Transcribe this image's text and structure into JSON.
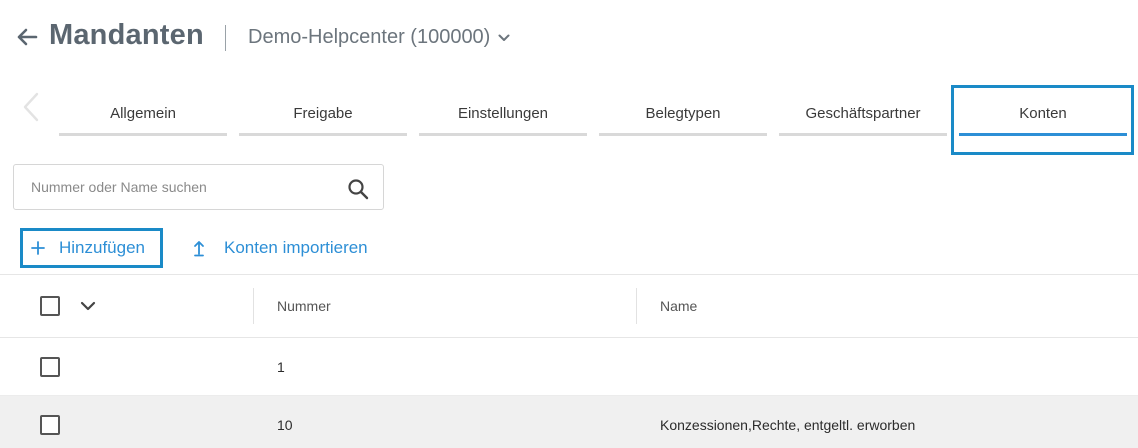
{
  "header": {
    "title": "Mandanten",
    "tenant": "Demo-Helpcenter (100000)"
  },
  "tabs": [
    {
      "label": "Allgemein",
      "active": false
    },
    {
      "label": "Freigabe",
      "active": false
    },
    {
      "label": "Einstellungen",
      "active": false
    },
    {
      "label": "Belegtypen",
      "active": false
    },
    {
      "label": "Geschäftspartner",
      "active": false
    },
    {
      "label": "Konten",
      "active": true
    }
  ],
  "search": {
    "placeholder": "Nummer oder Name suchen",
    "value": ""
  },
  "actions": {
    "add_label": "Hinzufügen",
    "import_label": "Konten importieren"
  },
  "table": {
    "columns": [
      "Nummer",
      "Name"
    ],
    "rows": [
      {
        "nummer": "1",
        "name": ""
      },
      {
        "nummer": "10",
        "name": "Konzessionen,Rechte, entgeltl. erworben"
      }
    ]
  },
  "colors": {
    "accent": "#2d8fd6",
    "highlight_border": "#1a8ac7",
    "title": "#5b6670"
  }
}
